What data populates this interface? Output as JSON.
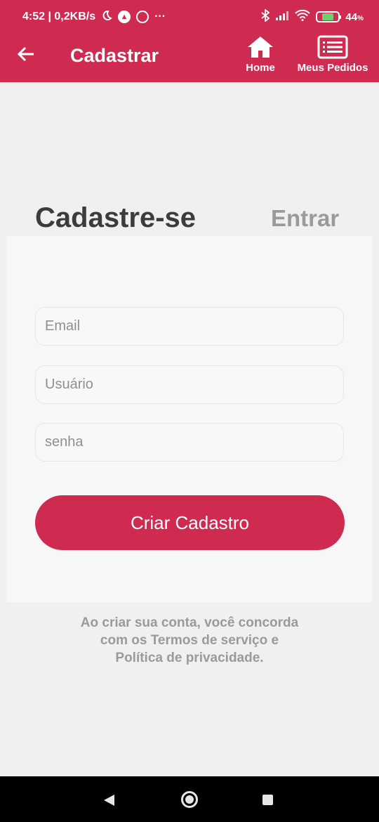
{
  "status_bar": {
    "time_speed": "4:52 | 0,2KB/s",
    "dots": "···",
    "battery": "44",
    "battery_unit": "%",
    "icons": [
      "moon-icon",
      "navigation-icon",
      "location-icon",
      "bluetooth-icon",
      "signal-icon",
      "wifi-icon",
      "battery-charging-icon"
    ]
  },
  "app_bar": {
    "title": "Cadastrar",
    "back_icon": "arrow-left-icon",
    "nav": [
      {
        "label": "Home",
        "icon": "home-icon"
      },
      {
        "label": "Meus Pedidos",
        "icon": "list-icon"
      }
    ]
  },
  "tabs": {
    "active": "Cadastre-se",
    "inactive": "Entrar"
  },
  "form": {
    "email_placeholder": "Email",
    "username_placeholder": "Usuário",
    "password_placeholder": "senha",
    "submit_label": "Criar Cadastro"
  },
  "terms": {
    "line1": "Ao criar sua conta, você concorda",
    "line2": "com os Termos de serviço e",
    "line3": "Política de privacidade."
  },
  "colors": {
    "brand": "#cf2a4f",
    "background": "#f0f0f0",
    "card": "#f7f7f7",
    "muted_text": "#9a9a9a"
  }
}
